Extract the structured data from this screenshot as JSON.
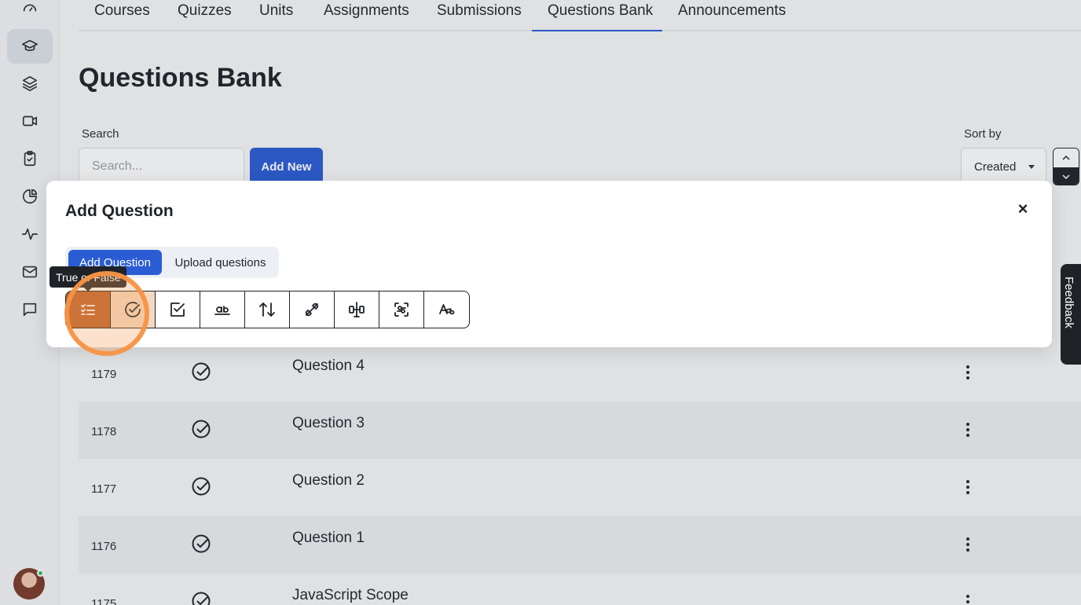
{
  "nav": {
    "tabs": [
      {
        "label": "Courses"
      },
      {
        "label": "Quizzes"
      },
      {
        "label": "Units"
      },
      {
        "label": "Assignments"
      },
      {
        "label": "Submissions"
      },
      {
        "label": "Questions Bank"
      },
      {
        "label": "Announcements"
      }
    ],
    "active_tab": "Questions Bank"
  },
  "page": {
    "title": "Questions Bank",
    "search_label": "Search",
    "search_placeholder": "Search...",
    "add_new_label": "Add New",
    "sort_label": "Sort by",
    "sort_value": "Created"
  },
  "sidebar": {
    "items": [
      {
        "icon": "dashboard-icon"
      },
      {
        "icon": "graduation-cap-icon",
        "active": true
      },
      {
        "icon": "layers-icon"
      },
      {
        "icon": "video-icon"
      },
      {
        "icon": "clipboard-check-icon"
      },
      {
        "icon": "pie-chart-icon"
      },
      {
        "icon": "activity-icon"
      },
      {
        "icon": "mail-icon"
      },
      {
        "icon": "message-icon"
      }
    ]
  },
  "table": {
    "rows": [
      {
        "id": "1179",
        "name": "Question 4"
      },
      {
        "id": "1178",
        "name": "Question 3"
      },
      {
        "id": "1177",
        "name": "Question 2"
      },
      {
        "id": "1176",
        "name": "Question 1"
      },
      {
        "id": "1175",
        "name": "JavaScript Scope"
      }
    ]
  },
  "modal": {
    "title": "Add Question",
    "close_label": "×",
    "segments": [
      "Add Question",
      "Upload questions"
    ],
    "tooltip": "True or False",
    "question_types": [
      "single-choice-icon",
      "true-false-icon",
      "multiple-choice-icon",
      "fill-in-blank-icon",
      "sorting-icon",
      "matching-icon",
      "image-matching-icon",
      "keywords-icon",
      "text-answer-icon"
    ]
  },
  "feedback": {
    "label": "Feedback"
  },
  "colors": {
    "accent": "#2a5cd4",
    "dark": "#1f2328",
    "highlight": "#f59446"
  }
}
